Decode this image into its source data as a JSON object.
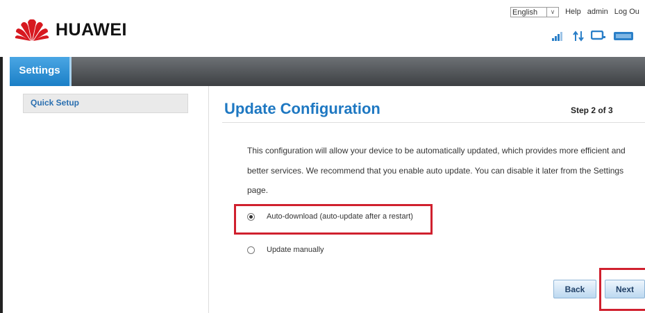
{
  "header": {
    "brand": "HUAWEI",
    "language": "English",
    "help": "Help",
    "user": "admin",
    "logout": "Log Ou"
  },
  "nav": {
    "settings_tab": "Settings"
  },
  "sidebar": {
    "quick_setup": "Quick Setup"
  },
  "main": {
    "title": "Update Configuration",
    "step": "Step 2 of 3",
    "description": "This configuration will allow your device to be automatically updated, which provides more efficient and better services. We recommend that you enable auto update. You can disable it later from the Settings page.",
    "options": [
      {
        "label": "Auto-download (auto-update after a restart)",
        "selected": true
      },
      {
        "label": "Update manually",
        "selected": false
      }
    ],
    "back_button": "Back",
    "next_button": "Next"
  },
  "colors": {
    "accent": "#1e78c2",
    "highlight": "#d0202e"
  }
}
